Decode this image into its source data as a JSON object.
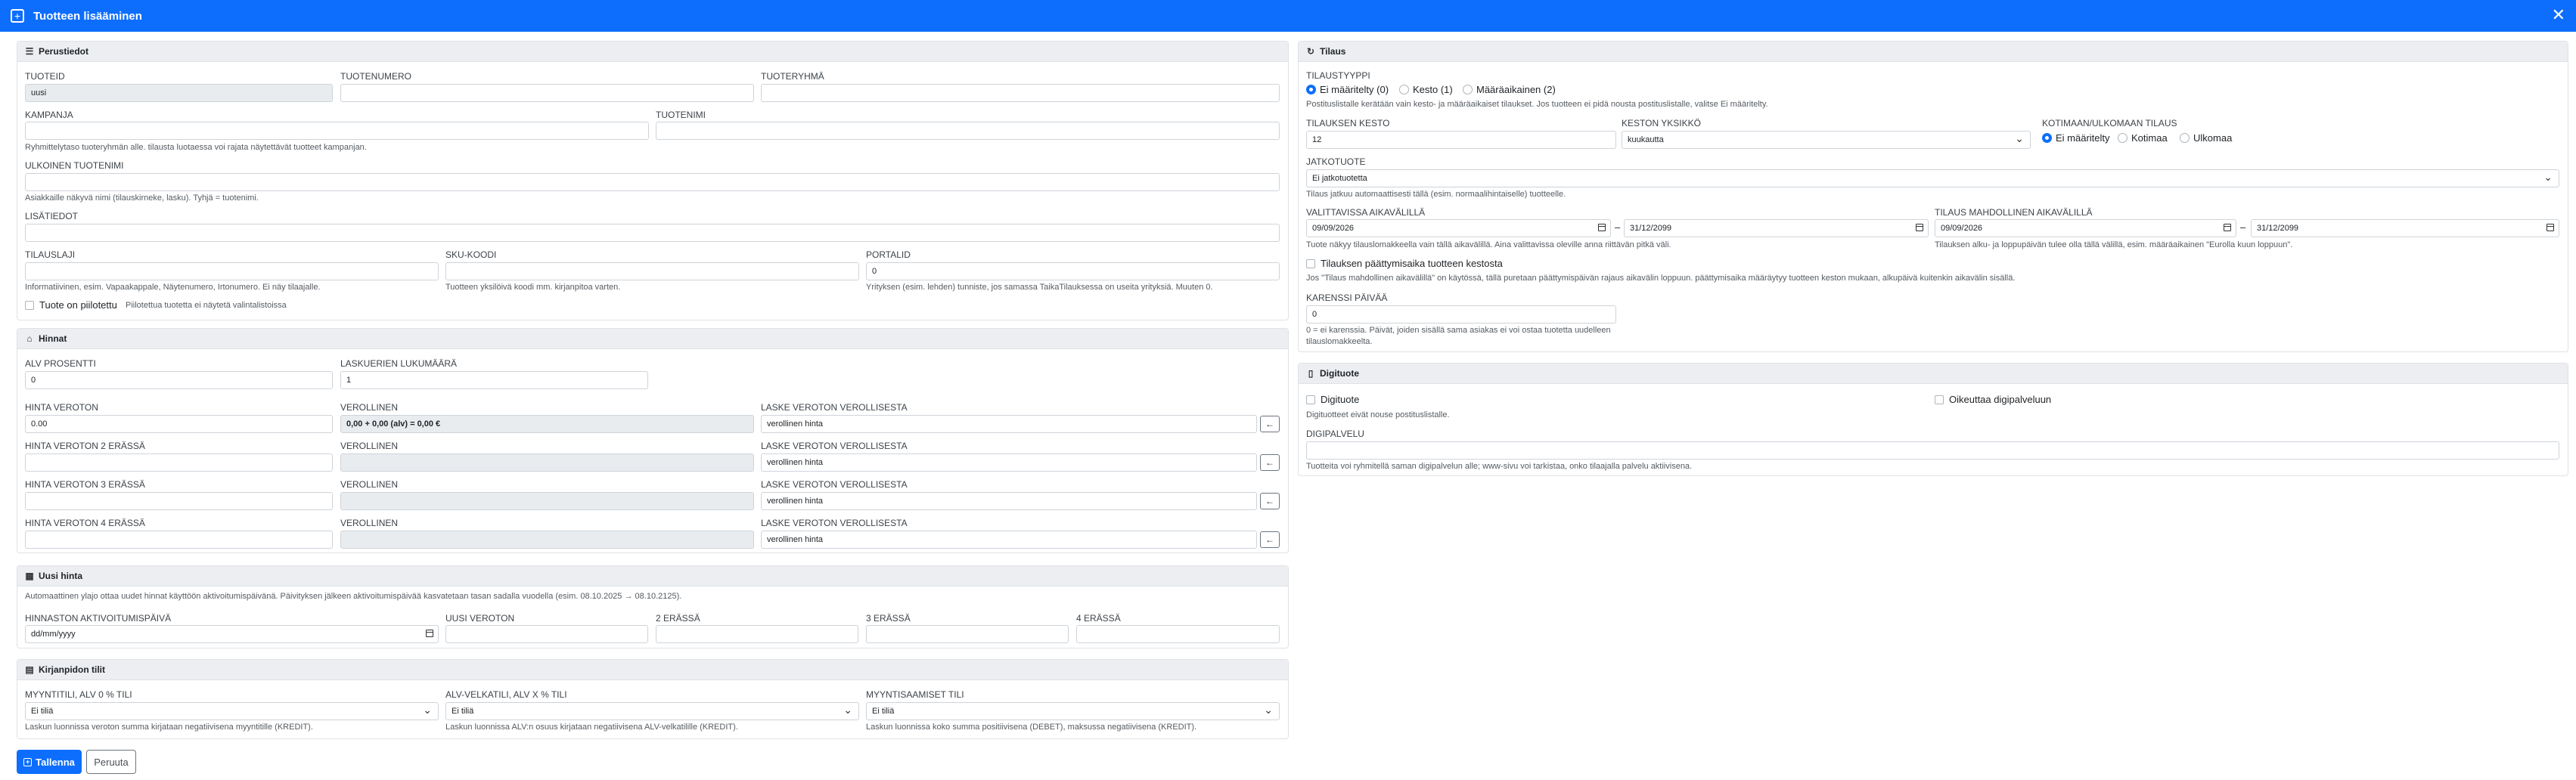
{
  "window": {
    "title": "Tuotteen lisääminen",
    "close": "✕"
  },
  "perustiedot": {
    "heading": "Perustiedot",
    "tuoteid_label": "TUOTEID",
    "tuoteid_value": "uusi",
    "tuotenumero_label": "TUOTENUMERO",
    "tuoteryhma_label": "TUOTERYHMÄ",
    "tuoteryhma_help": "Ryhmittelytaso tuoteryhmän alle. tilausta luotaessa voi rajata näytettävät tuotteet kampanjan.",
    "kampanja_label": "KAMPANJA",
    "tuotenimi_label": "TUOTENIMI",
    "ulkoinen_label": "ULKOINEN TUOTENIMI",
    "ulkoinen_help": "Asiakkaille näkyvä nimi (tilauskirneke, lasku). Tyhjä = tuotenimi.",
    "lisatiedot_label": "LISÄTIEDOT",
    "tilauslaji_label": "TILAUSLAJI",
    "tilauslaji_help": "Informatiivinen, esim. Vapaakappale, Näytenumero, Irtonumero. Ei näy tilaajalle.",
    "sku_label": "SKU-KOODI",
    "sku_help": "Tuotteen yksilöivä koodi mm. kirjanpitoa varten.",
    "portalid_label": "PORTALID",
    "portalid_value": "0",
    "portalid_help": "Yrityksen (esim. lehden) tunniste, jos samassa TaikaTilauksessa on useita yrityksiä. Muuten 0.",
    "piilotettu_label": "Tuote on piilotettu",
    "piilotettu_help": "Piilotettua tuotetta ei näytetä valintalistoissa"
  },
  "hinnat": {
    "heading": "Hinnat",
    "alv_label": "ALV PROSENTTI",
    "alv_value": "0",
    "laskuerat_label": "LASKUERIEN LUKUMÄÄRÄ",
    "laskuerat_value": "1",
    "rows": [
      {
        "label": "HINTA VEROTON",
        "value": "0.00",
        "ver_label": "VEROLLINEN",
        "ver_value": "0,00 + 0,00 (alv) = 0,00 €",
        "calc_label": "LASKE VEROTON VEROLLISESTA",
        "calc_placeholder": "verollinen hinta",
        "calc_btn": "←"
      },
      {
        "label": "HINTA VEROTON 2 ERÄSSÄ",
        "value": "",
        "ver_label": "VEROLLINEN",
        "ver_value": "",
        "calc_label": "LASKE VEROTON VEROLLISESTA",
        "calc_placeholder": "verollinen hinta",
        "calc_btn": "←"
      },
      {
        "label": "HINTA VEROTON 3 ERÄSSÄ",
        "value": "",
        "ver_label": "VEROLLINEN",
        "ver_value": "",
        "calc_label": "LASKE VEROTON VEROLLISESTA",
        "calc_placeholder": "verollinen hinta",
        "calc_btn": "←"
      },
      {
        "label": "HINTA VEROTON 4 ERÄSSÄ",
        "value": "",
        "ver_label": "VEROLLINEN",
        "ver_value": "",
        "calc_label": "LASKE VEROTON VEROLLISESTA",
        "calc_placeholder": "verollinen hinta",
        "calc_btn": "←"
      }
    ]
  },
  "uusihinta": {
    "heading": "Uusi hinta",
    "info": "Automaattinen ylajo ottaa uudet hinnat käyttöön aktivoitumispäivänä. Päivityksen jälkeen aktivoitumispäivää kasvatetaan tasan sadalla vuodella (esim. 08.10.2025 → 08.10.2125).",
    "aktivoitumis_label": "HINNASTON AKTIVOITUMISPÄIVÄ",
    "aktivoitumis_value": "dd/mm/yyyy",
    "uusi_label": "UUSI VEROTON",
    "era2_label": "2 ERÄSSÄ",
    "era3_label": "3 ERÄSSÄ",
    "era4_label": "4 ERÄSSÄ"
  },
  "kirjanpito": {
    "heading": "Kirjanpidon tilit",
    "myynti_label": "MYYNTITILI, ALV 0 % TILI",
    "myynti_value": "Ei tiliä",
    "myynti_help": "Laskun luonnissa veroton summa kirjataan negatiivisena myyntitille (KREDIT).",
    "alv_label": "ALV-VELKATILI, ALV X % TILI",
    "alv_value": "Ei tiliä",
    "alv_help": "Laskun luonnissa ALV:n osuus kirjataan negatiivisena ALV-velkatilille (KREDIT).",
    "saamiset_label": "MYYNTISAAMISET TILI",
    "saamiset_value": "Ei tiliä",
    "saamiset_help": "Laskun luonnissa koko summa positiivisena (DEBET), maksussa negatiivisena (KREDIT)."
  },
  "tilaus": {
    "heading": "Tilaus",
    "tyyppi_label": "TILAUSTYYPPI",
    "tyyppi_options": [
      "Ei määritelty (0)",
      "Kesto (1)",
      "Määräaikainen (2)"
    ],
    "tyyppi_help": "Postituslistalle kerätään vain kesto- ja määräaikaiset tilaukset. Jos tuotteen ei pidä nousta postituslistalle, valitse Ei määritelty.",
    "kesto_label": "TILAUKSEN KESTO",
    "kesto_value": "12",
    "yksikko_label": "KESTON YKSIKKÖ",
    "yksikko_value": "kuukautta",
    "kotimaa_label": "KOTIMAAN/ULKOMAAN TILAUS",
    "kotimaa_options": [
      "Ei määritelty",
      "Kotimaa",
      "Ulkomaa"
    ],
    "jatko_label": "JATKOTUOTE",
    "jatko_value": "Ei jatkotuotetta",
    "jatko_help": "Tilaus jatkuu automaattisesti tällä (esim. normaalihintaiselle) tuotteelle.",
    "valittavissa_label": "VALITTAVISSA AIKAVÄLILLÄ",
    "valittavissa_from": "09/09/2026",
    "valittavissa_to": "31/12/2099",
    "valittavissa_help": "Tuote näkyy tilauslomakkeella vain tällä aikavälillä. Aina valittavissa oleville anna riittävän pitkä väli.",
    "mahdollinen_label": "TILAUS MAHDOLLINEN AIKAVÄLILLÄ",
    "mahdollinen_from": "09/09/2026",
    "mahdollinen_to": "31/12/2099",
    "mahdollinen_help": "Tilauksen alku- ja loppupäivän tulee olla tällä välillä, esim. määräaikainen \"Eurolla kuun loppuun\".",
    "paattymis_label": "Tilauksen päättymisaika tuotteen kestosta",
    "paattymis_help": "Jos \"Tilaus mahdollinen aikavälillä\" on käytössä, tällä puretaan päättymispäivän rajaus aikavälin loppuun. päättymisaika määräytyy tuotteen keston mukaan, alkupäivä kuitenkin aikavälin sisällä.",
    "karenssi_label": "KARENSSI PÄIVÄÄ",
    "karenssi_value": "0",
    "karenssi_help1": "0 = ei karenssia. Päivät, joiden sisällä sama asiakas ei voi ostaa tuotetta uudelleen",
    "karenssi_help2": "tilauslomakkeelta."
  },
  "digituote": {
    "heading": "Digituote",
    "digi_label": "Digituote",
    "oikeuttaa_label": "Oikeuttaa digipalveluun",
    "digi_help": "Digituotteet eivät nouse postituslistalle.",
    "palvelu_label": "DIGIPALVELU",
    "palvelu_help": "Tuotteita voi ryhmitellä saman digipalvelun alle; www-sivu voi tarkistaa, onko tilaajalla palvelu aktiivisena."
  },
  "actions": {
    "save": "Tallenna",
    "cancel": "Peruuta"
  }
}
